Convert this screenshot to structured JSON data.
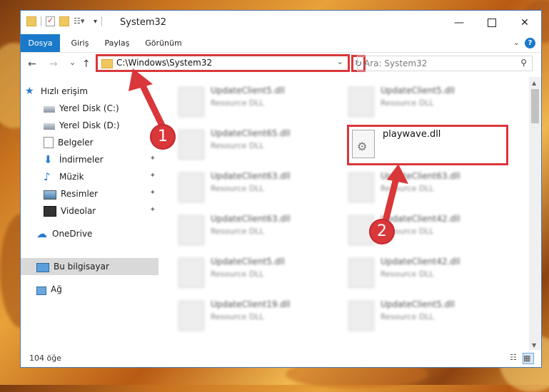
{
  "window": {
    "title": "System32"
  },
  "ribbon": {
    "tabs": [
      {
        "label": "Dosya",
        "active": true
      },
      {
        "label": "Giriş",
        "active": false
      },
      {
        "label": "Paylaş",
        "active": false
      },
      {
        "label": "Görünüm",
        "active": false
      }
    ],
    "help_label": "?"
  },
  "nav": {
    "back": "←",
    "forward": "→",
    "recent": "⌄",
    "up": "↑",
    "address": "C:\\Windows\\System32",
    "address_dropdown": "⌄",
    "refresh": "↻",
    "search_placeholder": "Ara: System32",
    "search_icon": "⚲"
  },
  "sidebar": {
    "items": [
      {
        "label": "Hızlı erişim",
        "icon": "star-icon",
        "pinned": false
      },
      {
        "label": "Yerel Disk (C:)",
        "icon": "drive-icon",
        "pinned": false
      },
      {
        "label": "Yerel Disk (D:)",
        "icon": "drive-icon",
        "pinned": false
      },
      {
        "label": "Belgeler",
        "icon": "documents-icon",
        "pinned": true
      },
      {
        "label": "İndirmeler",
        "icon": "download-icon",
        "pinned": true
      },
      {
        "label": "Müzik",
        "icon": "music-icon",
        "pinned": true
      },
      {
        "label": "Resimler",
        "icon": "pictures-icon",
        "pinned": true
      },
      {
        "label": "Videolar",
        "icon": "videos-icon",
        "pinned": true
      },
      {
        "label": "OneDrive",
        "icon": "cloud-icon",
        "pinned": false
      },
      {
        "label": "Bu bilgisayar",
        "icon": "computer-icon",
        "pinned": false,
        "selected": true
      },
      {
        "label": "Ağ",
        "icon": "network-icon",
        "pinned": false
      }
    ],
    "pin_glyph": "📌"
  },
  "files": {
    "left": [
      {
        "name": "UpdateClient5.dll",
        "desc": "Resource DLL"
      },
      {
        "name": "UpdateClient65.dll",
        "desc": "Resource DLL"
      },
      {
        "name": "UpdateClient63.dll",
        "desc": "Resource DLL"
      },
      {
        "name": "UpdateClient63.dll",
        "desc": "Resource DLL"
      },
      {
        "name": "UpdateClient5.dll",
        "desc": "Resource DLL"
      },
      {
        "name": "UpdateClient19.dll",
        "desc": "Resource DLL"
      }
    ],
    "right": [
      {
        "name": "UpdateClient5.dll",
        "desc": "Resource DLL"
      },
      {
        "name": "UpdateClient63.dll",
        "desc": "Resource DLL"
      },
      {
        "name": "UpdateClient42.dll",
        "desc": "Resource DLL"
      },
      {
        "name": "UpdateClient42.dll",
        "desc": "Resource DLL"
      },
      {
        "name": "UpdateClient5.dll",
        "desc": "Resource DLL"
      }
    ],
    "highlighted": {
      "name": "playwave.dll"
    }
  },
  "status": {
    "count": "104 öğe"
  },
  "annotations": {
    "badge1": "1",
    "badge2": "2"
  },
  "colors": {
    "accent": "#1979ca",
    "highlight": "#d9373a"
  }
}
